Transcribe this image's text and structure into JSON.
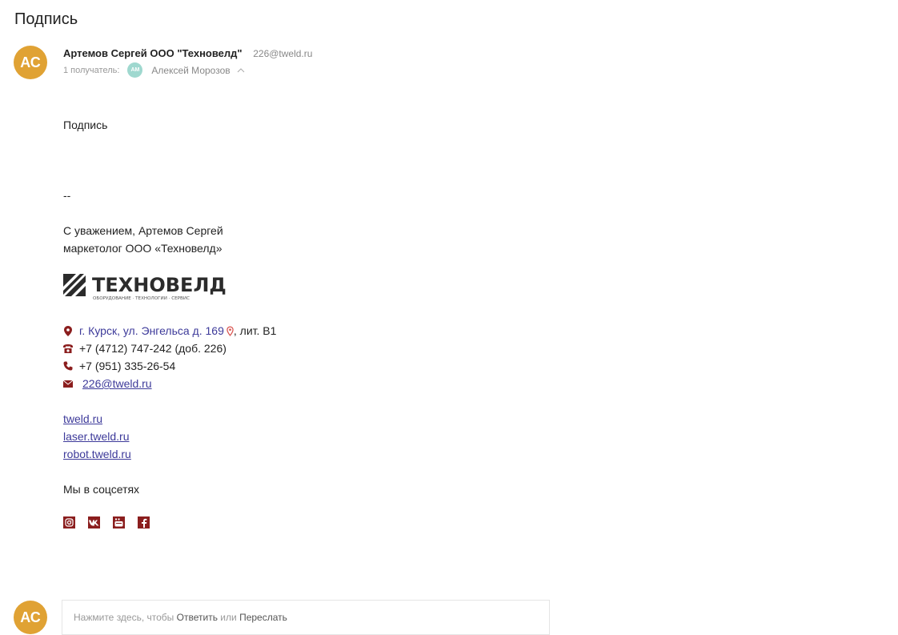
{
  "subject": "Подпись",
  "sender": {
    "avatar_initials": "АС",
    "name": "Артемов Сергей ООО \"Техновелд\"",
    "email": "226@tweld.ru"
  },
  "recipients": {
    "label": "1 получатель:",
    "avatar_initials": "АМ",
    "name": "Алексей Морозов"
  },
  "message": {
    "text": "Подпись",
    "separator": "--",
    "greeting": "С уважением, Артемов Сергей",
    "position": "маркетолог ООО «Техновелд»",
    "logo": {
      "title": "ТЕХНОВЕЛД",
      "tagline": "ОБОРУДОВАНИЕ · ТЕХНОЛОГИИ · СЕРВИС"
    },
    "contacts": {
      "address_link": "г. Курск, ул. Энгельса д. 169",
      "address_suffix": ", лит. В1",
      "phone_office": "+7 (4712) 747-242 (доб. 226)",
      "phone_mobile": "+7 (951) 335-26-54",
      "email": "226@tweld.ru"
    },
    "sites": [
      "tweld.ru",
      "laser.tweld.ru",
      "robot.tweld.ru"
    ],
    "social_heading": "Мы в соцсетях",
    "social_icons": [
      "instagram-icon",
      "vk-icon",
      "youtube-icon",
      "facebook-icon"
    ]
  },
  "reply": {
    "avatar_initials": "АС",
    "prompt": "Нажмите здесь, чтобы",
    "reply_action": "Ответить",
    "or": "или",
    "forward_action": "Переслать"
  },
  "colors": {
    "avatar": "#e0a234",
    "recipient_avatar": "#9fd8cf",
    "link": "#3d3a9a",
    "brand": "#8b1e1e"
  }
}
